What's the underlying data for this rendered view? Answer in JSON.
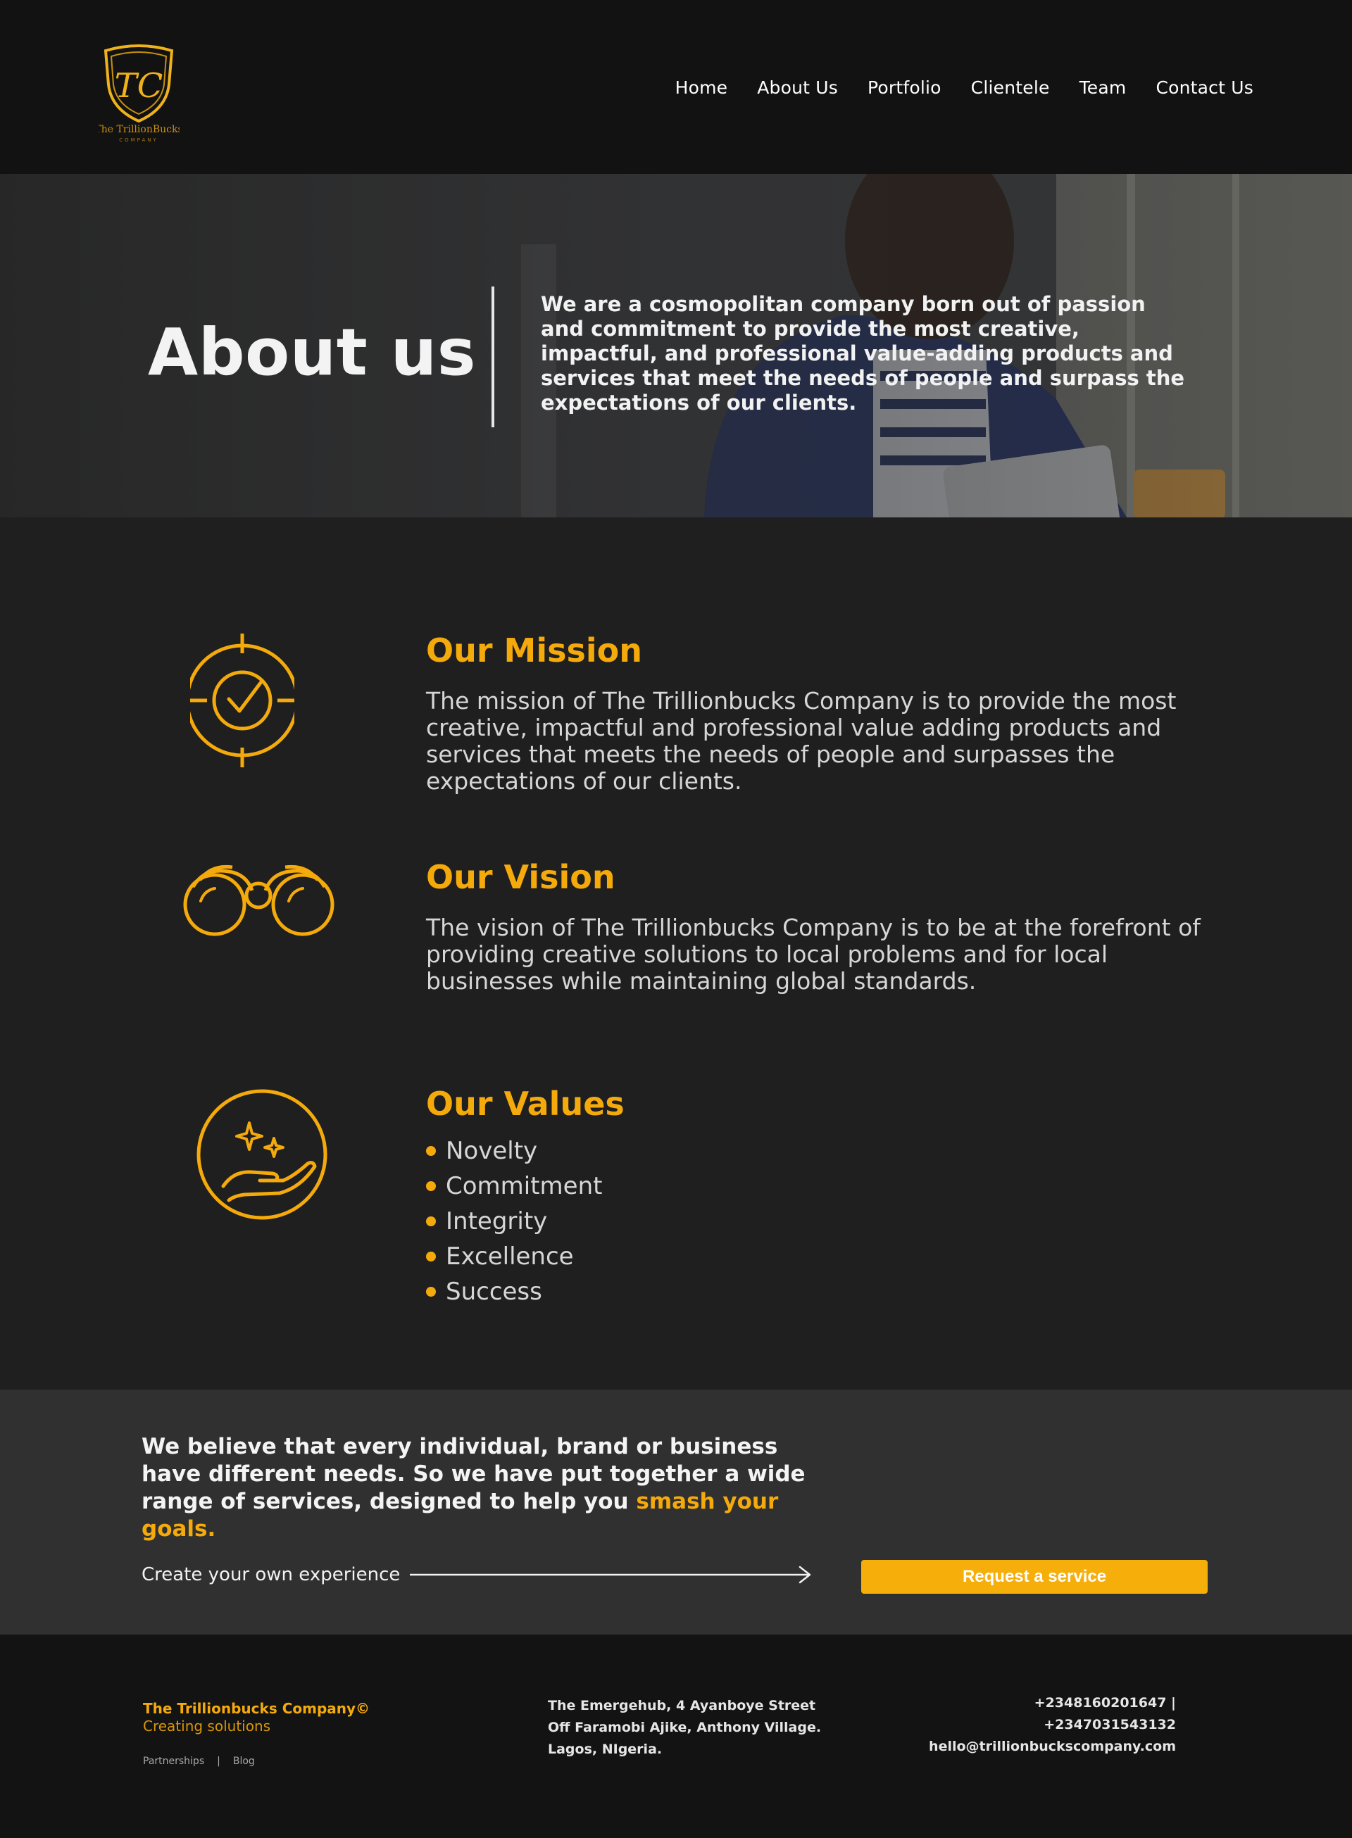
{
  "brand": {
    "logo_monogram": "TC",
    "logo_name": "The TrillionBucks",
    "logo_sub": "COMPANY"
  },
  "nav": {
    "items": [
      {
        "label": "Home"
      },
      {
        "label": "About Us"
      },
      {
        "label": "Portfolio"
      },
      {
        "label": "Clientele"
      },
      {
        "label": "Team"
      },
      {
        "label": "Contact Us"
      }
    ]
  },
  "hero": {
    "title": "About us",
    "text": "We are a cosmopolitan company born out of passion and commitment to provide the most creative, impactful, and professional value-adding products and services that meet the needs of people and surpass the expectations of our clients."
  },
  "mission": {
    "title": "Our Mission",
    "text": "The mission of The Trillionbucks Company is to provide the most creative, impactful and professional value adding products and services that meets the needs of people and surpasses the expectations of our clients.",
    "icon": "target-check-icon"
  },
  "vision": {
    "title": "Our Vision",
    "text": "The vision of The Trillionbucks Company is to be at the forefront of providing creative solutions to local problems and for local businesses while maintaining global standards.",
    "icon": "binoculars-icon"
  },
  "values": {
    "title": "Our Values",
    "icon": "hand-sparkles-icon",
    "items": [
      "Novelty",
      "Commitment",
      "Integrity",
      "Excellence",
      "Success"
    ]
  },
  "cta": {
    "text_main": "We believe that every individual, brand or business have different needs. So we have put together a wide range of services, designed to help you ",
    "text_highlight": "smash your goals.",
    "label": "Create your own experience",
    "button": "Request a service"
  },
  "footer": {
    "company": "The Trillionbucks Company©",
    "tagline": "Creating solutions",
    "links": [
      "Partnerships",
      "|",
      "Blog"
    ],
    "address_lines": [
      "The Emergehub, 4 Ayanboye Street",
      "Off Faramobi Ajike, Anthony Village.",
      "Lagos, NIgeria."
    ],
    "phones": "+2348160201647  | +2347031543132",
    "email": "hello@trillionbuckscompany.com"
  },
  "colors": {
    "accent": "#f5aa0c",
    "header_bg": "#121212",
    "body_bg": "#1f1f1f",
    "cta_bg": "#303030"
  }
}
